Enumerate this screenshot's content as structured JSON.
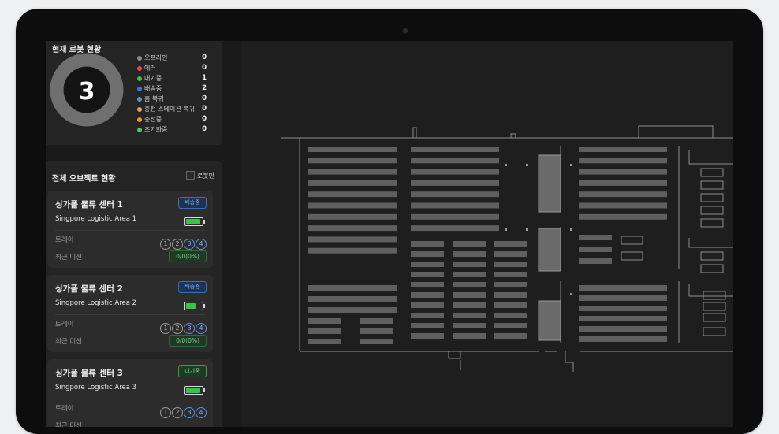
{
  "status_panel": {
    "title": "현재 로봇 현황",
    "total": "3",
    "legend": [
      {
        "label": "오프라인",
        "count": "0",
        "color": "#8a8a8a"
      },
      {
        "label": "에러",
        "count": "0",
        "color": "#e5484d"
      },
      {
        "label": "대기중",
        "count": "1",
        "color": "#3fbf5a"
      },
      {
        "label": "배송중",
        "count": "2",
        "color": "#3e74d6"
      },
      {
        "label": "홈 복귀",
        "count": "0",
        "color": "#5a8fc9"
      },
      {
        "label": "충전 스테이션 복귀",
        "count": "0",
        "color": "#e0a060"
      },
      {
        "label": "충전중",
        "count": "0",
        "color": "#f0923a"
      },
      {
        "label": "초기화중",
        "count": "0",
        "color": "#4fbf7a"
      }
    ]
  },
  "object_panel": {
    "title": "전체 오브젝트 현황",
    "robot_only_label": "로봇만",
    "centers": [
      {
        "name": "싱가폴 물류 센터 1",
        "badge": "배송중",
        "badge_type": "blue",
        "area": "Singpore Logistic Area 1",
        "battery": 0.9,
        "tray_label": "트레이",
        "trays": [
          "1",
          "2",
          "3",
          "4"
        ],
        "active_trays": [
          3,
          4
        ],
        "mission_label": "최근 미션",
        "progress": "0/0(0%)"
      },
      {
        "name": "싱가폴 물류 센터 2",
        "badge": "배송중",
        "badge_type": "blue",
        "area": "Singpore Logistic Area 2",
        "battery": 0.6,
        "tray_label": "트레이",
        "trays": [
          "1",
          "2",
          "3",
          "4"
        ],
        "active_trays": [
          3,
          4
        ],
        "mission_label": "최근 미션",
        "progress": "0/0(0%)"
      },
      {
        "name": "싱가폴 물류 센터 3",
        "badge": "대기중",
        "badge_type": "green",
        "area": "Singpore Logistic Area 3",
        "battery": 0.9,
        "tray_label": "트레이",
        "trays": [
          "1",
          "2",
          "3",
          "4"
        ],
        "active_trays": [
          3,
          4
        ],
        "mission_label": "최근 미션",
        "progress": ""
      }
    ]
  }
}
